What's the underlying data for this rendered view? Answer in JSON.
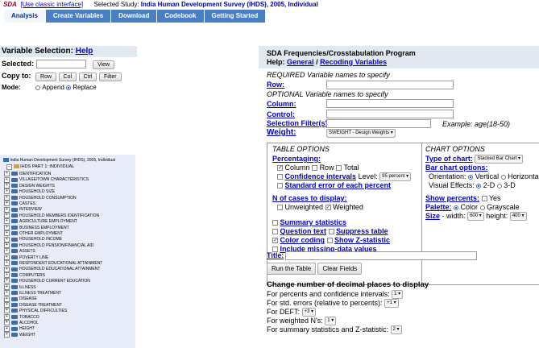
{
  "header": {
    "sda_label": "SDA",
    "classic_link": "[Use classic interface]",
    "selected_study_label": "Selected Study:",
    "study_name": "India Human Development Survey (IHDS), 2005, Individual",
    "tabs": [
      "Analysis",
      "Create Variables",
      "Download",
      "Codebook",
      "Getting Started"
    ]
  },
  "left": {
    "title": "Variable Selection:",
    "help": "Help",
    "selected_label": "Selected:",
    "view_btn": "View",
    "copy_label": "Copy to:",
    "copy_btns": [
      "Row",
      "Col",
      "Ctrl",
      "Filter"
    ],
    "mode_label": "Mode:",
    "mode_append": "Append",
    "mode_replace": "Replace",
    "tree_root": "India Human Development Survey (IHDS), 2005, Individual",
    "tree_part": "IHDS PART 1: INDIVIDUAL",
    "tree_items": [
      "IDENTIFICATION",
      "VILLAGE/TOWN CHARACTERISTICS",
      "DESIGN WEIGHTS",
      "HOUSEHOLD SIZE",
      "HOUSEHOLD CONSUMPTION",
      "CASTES",
      "INTERVIEW",
      "HOUSEHOLD MEMBERS IDENTIFICATION",
      "AGRICULTURE EMPLOYMENT",
      "BUSINESS EMPLOYMENT",
      "OTHER EMPLOYMENT",
      "HOUSEHOLD INCOME",
      "HOUSEHOLD PENSION/FINANCIAL AID",
      "ASSETS",
      "POVERTY LINE",
      "RESPONDENT EDUCATIONAL ATTAINMENT",
      "HOUSEHOLD EDUCATIONAL ATTAINMENT",
      "COMPUTERS",
      "HOUSEHOLD CURRENT EDUCATION",
      "ILLNESS",
      "ILLNESS TREATMENT",
      "DISEASE",
      "DISEASE TREATMENT",
      "PHYSICAL DIFFICULTIES",
      "TOBACCO",
      "ALCOHOL",
      "HEIGHT",
      "WEIGHT"
    ]
  },
  "right": {
    "title": "SDA Frequencies/Crosstabulation Program",
    "help_label": "Help:",
    "help_general": "General",
    "help_sep": "/",
    "help_recoding": "Recoding Variables",
    "required_text": "REQUIRED Variable names to specify",
    "row_label": "Row:",
    "optional_text": "OPTIONAL Variable names to specify",
    "column_label": "Column:",
    "control_label": "Control:",
    "filter_label": "Selection Filter(s):",
    "filter_example": "Example: age(18-50)",
    "weight_label": "Weight:",
    "weight_value": "SWEIGHT - Design Weights",
    "table_options": {
      "title": "TABLE OPTIONS",
      "percentaging": "Percentaging:",
      "pct_column": "Column",
      "pct_row": "Row",
      "pct_total": "Total",
      "conf_intervals": "Confidence intervals",
      "level_label": "Level:",
      "level_value": "95 percent",
      "std_error": "Standard error of each percent",
      "ncases": "N of cases to display:",
      "unweighted": "Unweighted",
      "weighted": "Weighted",
      "summary_stats": "Summary statistics",
      "question_text": "Question text",
      "suppress_table": "Suppress table",
      "color_coding": "Color coding",
      "show_z": "Show Z-statistic",
      "missing_data": "Include missing-data values"
    },
    "chart_options": {
      "title": "CHART OPTIONS",
      "type_label": "Type of chart:",
      "type_value": "Stacked Bar Chart",
      "bar_options": "Bar chart options:",
      "orientation_label": "Orientation:",
      "vertical": "Vertical",
      "horizontal": "Horizontal",
      "visual_label": "Visual Effects:",
      "effect_2d": "2-D",
      "effect_3d": "3-D",
      "show_pct": "Show percents:",
      "yes": "Yes",
      "palette": "Palette:",
      "color": "Color",
      "grayscale": "Grayscale",
      "size": "Size",
      "width_label": "- width:",
      "width_value": "600",
      "height_label": "height:",
      "height_value": "400"
    },
    "title_label": "Title:",
    "run_btn": "Run the Table",
    "clear_btn": "Clear Fields",
    "decimals": {
      "title": "Change number of decimal places to display",
      "pct_label": "For percents and confidence intervals:",
      "pct_value": "1",
      "std_label": "For std. errors (relative to percents):",
      "std_value": "+1",
      "deft_label": "For DEFT:",
      "deft_value": "+3",
      "wn_label": "For weighted N's:",
      "wn_value": "1",
      "sum_label": "For summary statistics and Z-statistic:",
      "sum_value": "2"
    }
  }
}
